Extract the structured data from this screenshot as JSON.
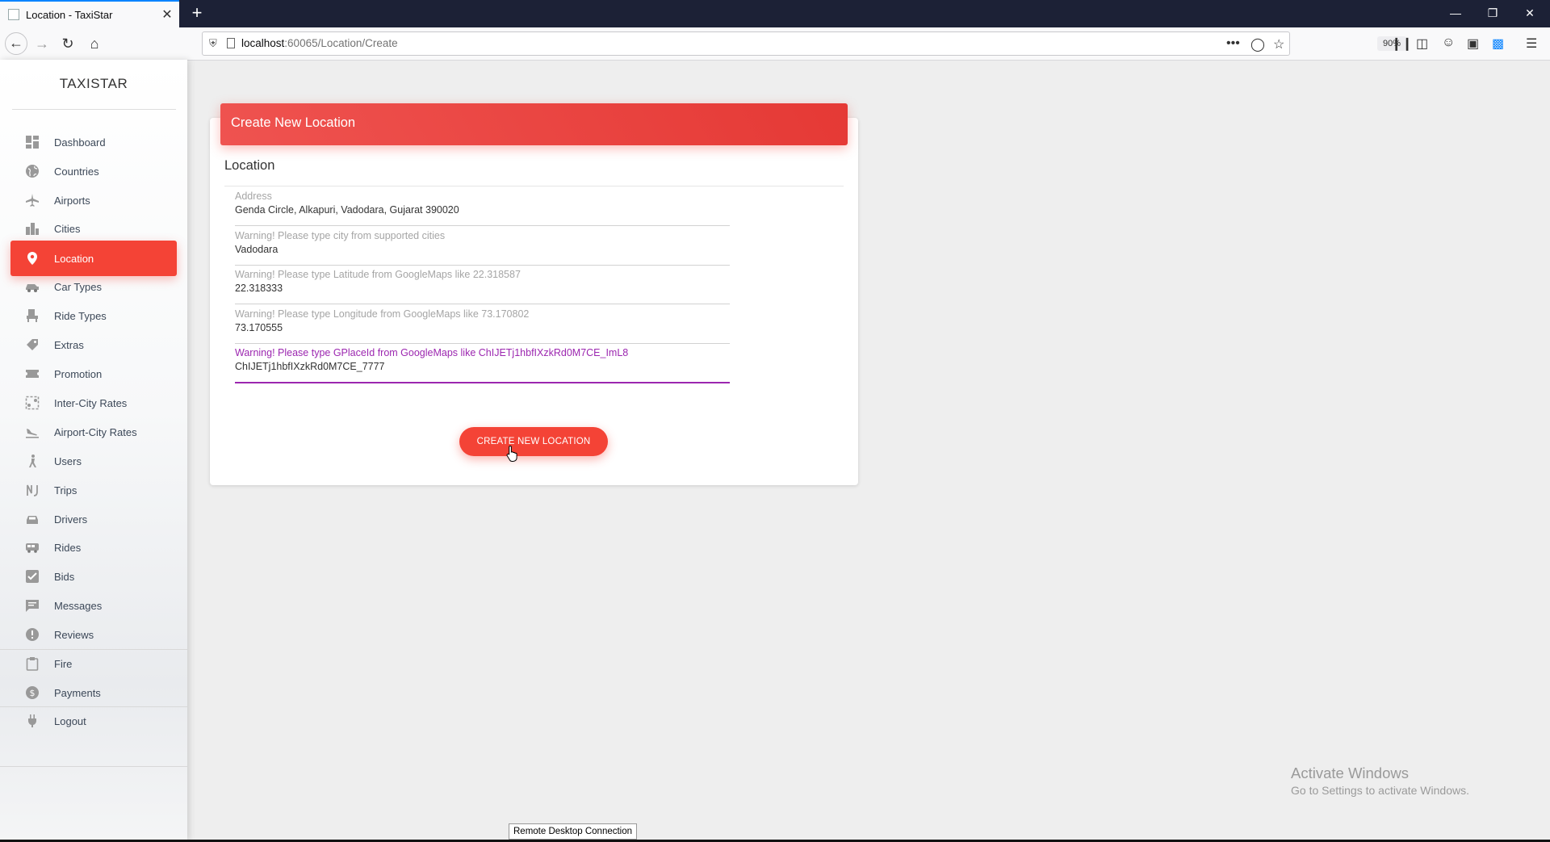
{
  "browser": {
    "tab_title": "Location - TaxiStar",
    "new_tab_label": "+",
    "url_host": "localhost",
    "url_path": ":60065/Location/Create",
    "zoom": "90%"
  },
  "sidebar": {
    "brand": "TAXISTAR",
    "items": [
      {
        "label": "Dashboard",
        "icon": "dashboard-icon"
      },
      {
        "label": "Countries",
        "icon": "globe-icon"
      },
      {
        "label": "Airports",
        "icon": "airplane-icon"
      },
      {
        "label": "Cities",
        "icon": "city-icon"
      },
      {
        "label": "Location",
        "icon": "location-pin-icon",
        "active": true
      },
      {
        "label": "Car Types",
        "icon": "car-icon"
      },
      {
        "label": "Ride Types",
        "icon": "seat-icon"
      },
      {
        "label": "Extras",
        "icon": "tag-icon"
      },
      {
        "label": "Promotion",
        "icon": "ticket-icon"
      },
      {
        "label": "Inter-City Rates",
        "icon": "route-icon"
      },
      {
        "label": "Airport-City Rates",
        "icon": "flight-landing-icon"
      },
      {
        "label": "Users",
        "icon": "person-icon"
      },
      {
        "label": "Trips",
        "icon": "trips-icon"
      },
      {
        "label": "Drivers",
        "icon": "driver-car-icon"
      },
      {
        "label": "Rides",
        "icon": "bus-icon"
      },
      {
        "label": "Bids",
        "icon": "checkbox-icon"
      },
      {
        "label": "Messages",
        "icon": "message-icon"
      },
      {
        "label": "Reviews",
        "icon": "review-badge-icon"
      },
      {
        "label": "Fire",
        "icon": "clipboard-icon"
      },
      {
        "label": "Payments",
        "icon": "dollar-icon"
      },
      {
        "label": "Logout",
        "icon": "power-plug-icon"
      }
    ]
  },
  "card": {
    "header_title": "Create New Location",
    "section_title": "Location",
    "fields": [
      {
        "label": "Address",
        "value": "Genda Circle, Alkapuri, Vadodara, Gujarat 390020"
      },
      {
        "label": "Warning! Please type city from supported cities",
        "value": "Vadodara"
      },
      {
        "label": "Warning! Please type Latitude from GoogleMaps like 22.318587",
        "value": "22.318333"
      },
      {
        "label": "Warning! Please type Longitude from GoogleMaps like 73.170802",
        "value": "73.170555"
      },
      {
        "label": "Warning! Please type GPlaceId from GoogleMaps like ChIJETj1hbfIXzkRd0M7CE_ImL8",
        "value": "ChIJETj1hbfIXzkRd0M7CE_7777",
        "focused": true
      }
    ],
    "submit_label": "CREATE NEW LOCATION"
  },
  "overlays": {
    "watermark_title": "Activate Windows",
    "watermark_sub": "Go to Settings to activate Windows.",
    "rdc_label": "Remote Desktop Connection"
  },
  "colors": {
    "accent": "#f44336",
    "focus": "#9c27b0",
    "tabbar": "#1c2136"
  }
}
